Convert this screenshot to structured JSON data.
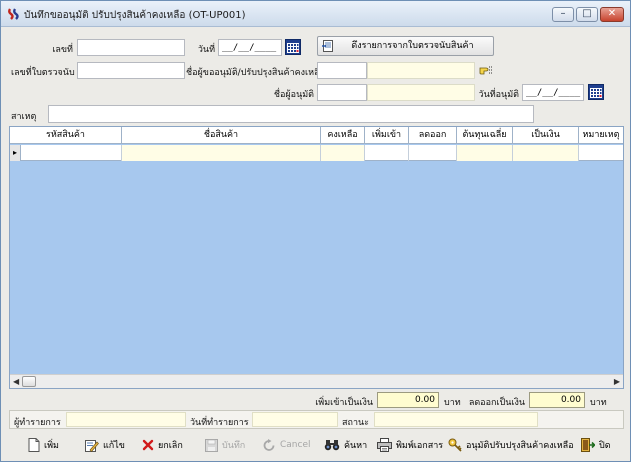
{
  "window": {
    "title": "บันทึกขออนุมัติ ปรับปรุงสินค้าคงเหลือ (OT-UP001)",
    "controls": {
      "minimize": "–",
      "maximize": "□",
      "close": "✕"
    }
  },
  "header": {
    "doc_no_label": "เลขที่",
    "date_label": "วันที่",
    "date_value": "__/__/____",
    "fetch_button_label": "ดึงรายการจากใบตรวจนับสินค้า",
    "count_doc_label": "เลขที่ใบตรวจนับ",
    "requester_label": "ชื่อผู้ขออนุมัติ/ปรับปรุงสินค้าคงเหลือ",
    "approver_label": "ชื่อผู้อนุมัติ",
    "approve_date_label": "วันที่อนุมัติ",
    "approve_date_value": "__/__/____",
    "remark_label": "สาเหตุ"
  },
  "grid": {
    "columns": [
      "รหัสสินค้า",
      "ชื่อสินค้า",
      "คงเหลือ",
      "เพิ่มเข้า",
      "ลดออก",
      "ต้นทุนเฉลี่ย",
      "เป็นเงิน",
      "หมายเหตุ"
    ],
    "row_indicator": "▸"
  },
  "totals": {
    "increase_label": "เพิ่มเข้าเป็นเงิน",
    "increase_value": "0.00",
    "decrease_label": "ลดออกเป็นเงิน",
    "decrease_value": "0.00",
    "currency": "บาท"
  },
  "status": {
    "creator_label": "ผู้ทำรายการ",
    "created_date_label": "วันที่ทำรายการ",
    "state_label": "สถานะ"
  },
  "toolbar": {
    "add": "เพิ่ม",
    "edit": "แก้ไข",
    "cancel_doc": "ยกเลิก",
    "save": "บันทึก",
    "cancel": "Cancel",
    "search": "ค้นหา",
    "print": "พิมพ์เอกสาร",
    "approve": "อนุมัติปรับปรุงสินค้าคงเหลือ",
    "close": "ปิด"
  }
}
